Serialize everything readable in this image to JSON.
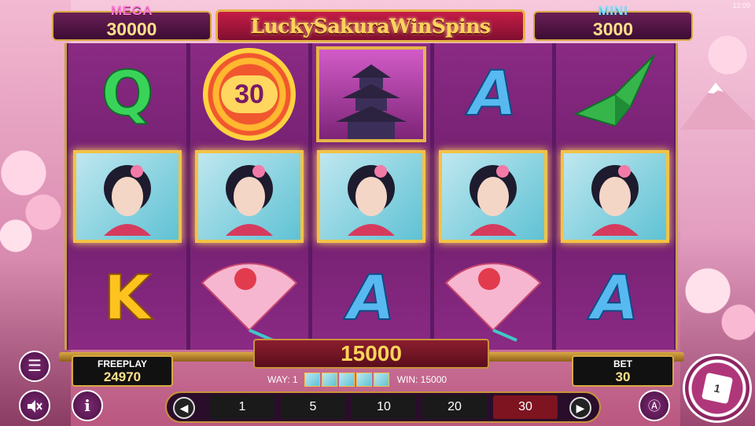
{
  "system": {
    "clock": "12:09"
  },
  "jackpots": {
    "mega": {
      "label": "MEGA",
      "value": "30000"
    },
    "mini": {
      "label": "MINI",
      "value": "3000"
    }
  },
  "title": "LuckySakuraWinSpins",
  "reels": [
    [
      "letter-Q",
      "geisha",
      "letter-K"
    ],
    [
      "coin-30",
      "geisha",
      "fan"
    ],
    [
      "pagoda",
      "geisha",
      "letter-A"
    ],
    [
      "letter-A",
      "geisha",
      "fan"
    ],
    [
      "crane",
      "geisha",
      "letter-A"
    ]
  ],
  "symbols": {
    "q": "Q",
    "k": "K",
    "a": "A",
    "coin_value": "30"
  },
  "win_amount": "15000",
  "freeplay": {
    "label": "FREEPLAY",
    "value": "24970"
  },
  "bet": {
    "label": "BET",
    "value": "30"
  },
  "info": {
    "way_label": "WAY: 1",
    "win_label": "WIN: 15000"
  },
  "bet_options": [
    "1",
    "5",
    "10",
    "20",
    "30"
  ],
  "selected_bet": "30",
  "spin_button": {
    "badge": "1"
  },
  "colors": {
    "accent_gold": "#d9a843",
    "reel_bg": "#8b2a84",
    "selected_bet": "#7d1420"
  },
  "icons": {
    "menu": "hamburger-icon",
    "sound": "speaker-muted-icon",
    "info": "info-icon",
    "autoplay": "autoplay-icon",
    "prev": "chevron-left-icon",
    "next": "chevron-right-icon"
  }
}
